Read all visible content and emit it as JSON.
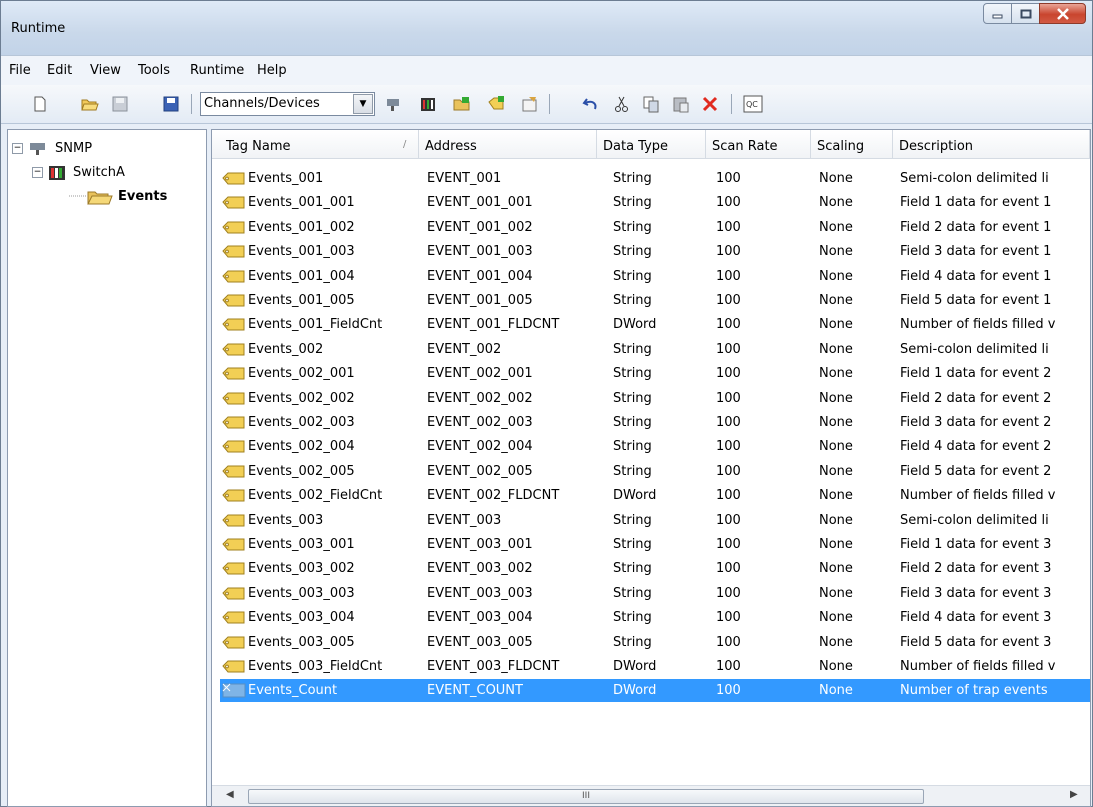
{
  "window": {
    "title": "Runtime"
  },
  "menu": [
    "File",
    "Edit",
    "View",
    "Tools",
    "Runtime",
    "Help"
  ],
  "toolbar": {
    "view_combo": "Channels/Devices"
  },
  "tree": [
    {
      "label": "SNMP",
      "level": 0
    },
    {
      "label": "SwitchA",
      "level": 1
    },
    {
      "label": "Events",
      "level": 2
    }
  ],
  "columns": [
    "Tag Name",
    "Address",
    "Data Type",
    "Scan Rate",
    "Scaling",
    "Description"
  ],
  "rows": [
    [
      "Events_001",
      "EVENT_001",
      "String",
      "100",
      "None",
      "Semi-colon delimited li"
    ],
    [
      "Events_001_001",
      "EVENT_001_001",
      "String",
      "100",
      "None",
      "Field 1 data for event 1"
    ],
    [
      "Events_001_002",
      "EVENT_001_002",
      "String",
      "100",
      "None",
      "Field 2 data for event 1"
    ],
    [
      "Events_001_003",
      "EVENT_001_003",
      "String",
      "100",
      "None",
      "Field 3 data for event 1"
    ],
    [
      "Events_001_004",
      "EVENT_001_004",
      "String",
      "100",
      "None",
      "Field 4 data for event 1"
    ],
    [
      "Events_001_005",
      "EVENT_001_005",
      "String",
      "100",
      "None",
      "Field 5 data for event 1"
    ],
    [
      "Events_001_FieldCnt",
      "EVENT_001_FLDCNT",
      "DWord",
      "100",
      "None",
      "Number of fields filled v"
    ],
    [
      "Events_002",
      "EVENT_002",
      "String",
      "100",
      "None",
      "Semi-colon delimited li"
    ],
    [
      "Events_002_001",
      "EVENT_002_001",
      "String",
      "100",
      "None",
      "Field 1 data for event 2"
    ],
    [
      "Events_002_002",
      "EVENT_002_002",
      "String",
      "100",
      "None",
      "Field 2 data for event 2"
    ],
    [
      "Events_002_003",
      "EVENT_002_003",
      "String",
      "100",
      "None",
      "Field 3 data for event 2"
    ],
    [
      "Events_002_004",
      "EVENT_002_004",
      "String",
      "100",
      "None",
      "Field 4 data for event 2"
    ],
    [
      "Events_002_005",
      "EVENT_002_005",
      "String",
      "100",
      "None",
      "Field 5 data for event 2"
    ],
    [
      "Events_002_FieldCnt",
      "EVENT_002_FLDCNT",
      "DWord",
      "100",
      "None",
      "Number of fields filled v"
    ],
    [
      "Events_003",
      "EVENT_003",
      "String",
      "100",
      "None",
      "Semi-colon delimited li"
    ],
    [
      "Events_003_001",
      "EVENT_003_001",
      "String",
      "100",
      "None",
      "Field 1 data for event 3"
    ],
    [
      "Events_003_002",
      "EVENT_003_002",
      "String",
      "100",
      "None",
      "Field 2 data for event 3"
    ],
    [
      "Events_003_003",
      "EVENT_003_003",
      "String",
      "100",
      "None",
      "Field 3 data for event 3"
    ],
    [
      "Events_003_004",
      "EVENT_003_004",
      "String",
      "100",
      "None",
      "Field 4 data for event 3"
    ],
    [
      "Events_003_005",
      "EVENT_003_005",
      "String",
      "100",
      "None",
      "Field 5 data for event 3"
    ],
    [
      "Events_003_FieldCnt",
      "EVENT_003_FLDCNT",
      "DWord",
      "100",
      "None",
      "Number of fields filled v"
    ],
    [
      "Events_Count",
      "EVENT_COUNT",
      "DWord",
      "100",
      "None",
      "Number of trap events"
    ]
  ],
  "selected_row": 21,
  "icons": [
    "new-project-icon",
    "open-icon",
    "save-icon",
    "save-as-icon",
    "new-channel-icon",
    "new-device-icon",
    "new-tag-group-icon",
    "new-tag-icon",
    "properties-icon",
    "undo-icon",
    "cut-icon",
    "copy-icon",
    "paste-icon",
    "delete-icon",
    "quick-client-icon"
  ]
}
